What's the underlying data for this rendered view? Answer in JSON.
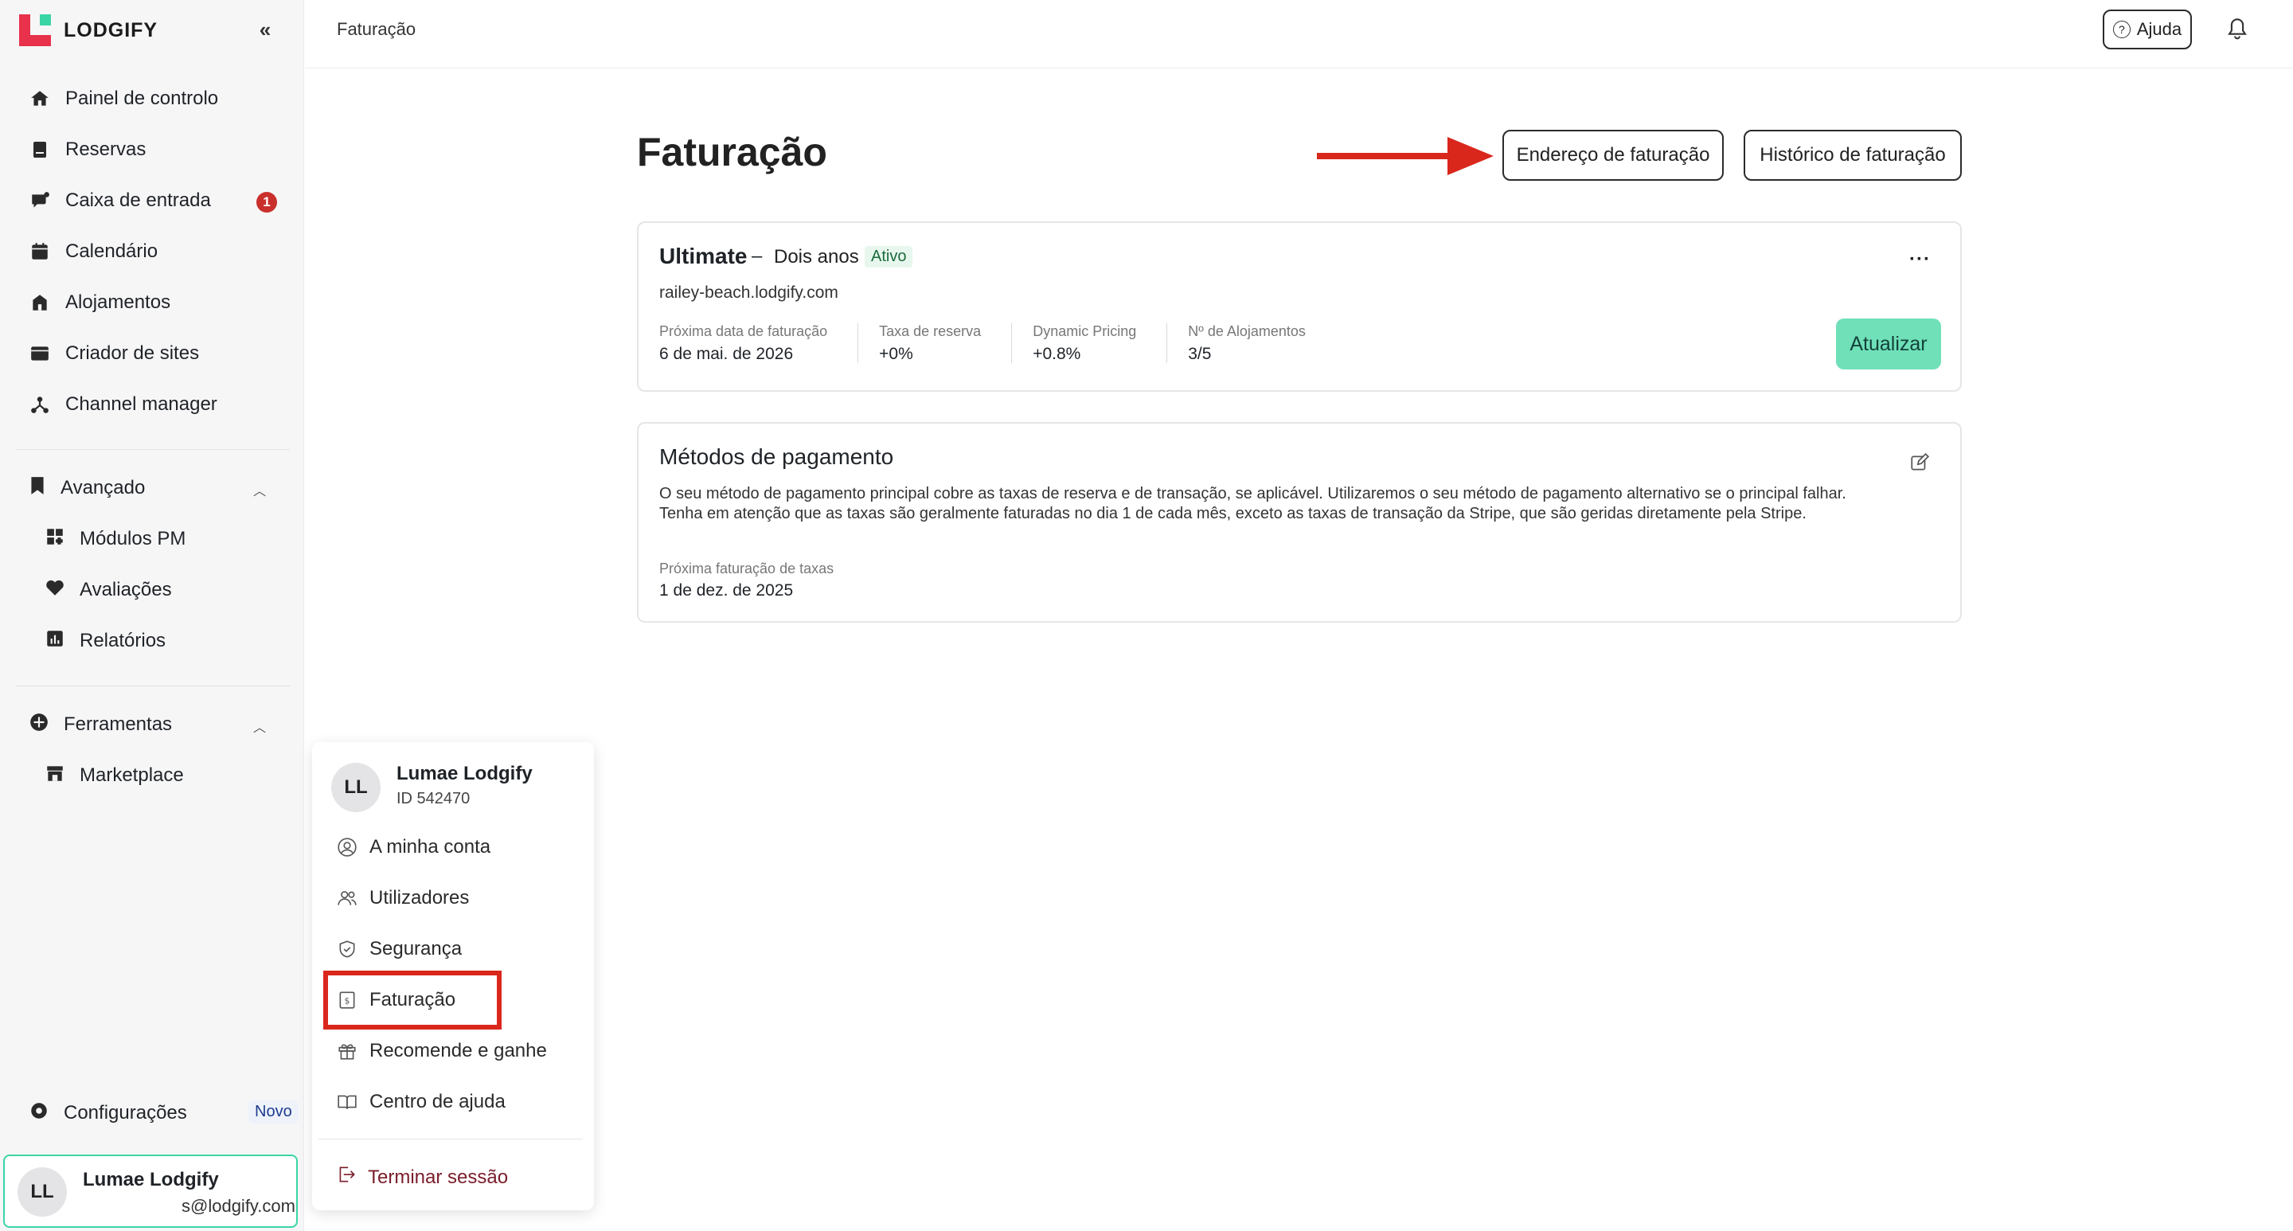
{
  "brand": {
    "name": "LODGIFY"
  },
  "sidebar": {
    "main_items": [
      {
        "label": "Painel de controlo",
        "icon": "home-icon"
      },
      {
        "label": "Reservas",
        "icon": "bookings-icon"
      },
      {
        "label": "Caixa de entrada",
        "icon": "inbox-icon",
        "badge": "1"
      },
      {
        "label": "Calendário",
        "icon": "calendar-icon"
      },
      {
        "label": "Alojamentos",
        "icon": "property-icon"
      },
      {
        "label": "Criador de sites",
        "icon": "website-icon"
      },
      {
        "label": "Channel manager",
        "icon": "channel-icon"
      }
    ],
    "advanced": {
      "label": "Avançado",
      "items": [
        {
          "label": "Módulos PM",
          "icon": "modules-icon"
        },
        {
          "label": "Avaliações",
          "icon": "heart-icon"
        },
        {
          "label": "Relatórios",
          "icon": "reports-icon"
        }
      ]
    },
    "tools": {
      "label": "Ferramentas",
      "items": [
        {
          "label": "Marketplace",
          "icon": "store-icon"
        }
      ]
    },
    "settings": {
      "label": "Configurações",
      "badge": "Novo"
    },
    "user": {
      "initials": "LL",
      "name": "Lumae Lodgify",
      "email": "s@lodgify.com"
    }
  },
  "topbar": {
    "breadcrumb": "Faturação",
    "help_label": "Ajuda"
  },
  "main": {
    "title": "Faturação",
    "address_button": "Endereço de faturação",
    "history_button": "Histórico de faturação",
    "plan": {
      "name": "Ultimate",
      "dash": "–",
      "term": "Dois anos",
      "status": "Ativo",
      "domain": "railey-beach.lodgify.com",
      "more": "···",
      "stats": [
        {
          "label": "Próxima data de faturação",
          "value": "6 de mai. de 2026"
        },
        {
          "label": "Taxa de reserva",
          "value": "+0%"
        },
        {
          "label": "Dynamic Pricing",
          "value": "+0.8%"
        },
        {
          "label": "Nº de Alojamentos",
          "value": "3/5"
        }
      ],
      "update_button": "Atualizar"
    },
    "payment": {
      "title": "Métodos de pagamento",
      "description": "O seu método de pagamento principal cobre as taxas de reserva e de transação, se aplicável. Utilizaremos o seu método de pagamento alternativo se o principal falhar. Tenha em atenção que as taxas são geralmente faturadas no dia 1 de cada mês, exceto as taxas de transação da Stripe, que são geridas diretamente pela Stripe.",
      "next_label": "Próxima faturação de taxas",
      "next_date": "1 de dez. de 2025"
    }
  },
  "user_menu": {
    "initials": "LL",
    "name": "Lumae Lodgify",
    "id": "ID 542470",
    "items": [
      {
        "label": "A minha conta",
        "icon": "account-icon"
      },
      {
        "label": "Utilizadores",
        "icon": "users-icon"
      },
      {
        "label": "Segurança",
        "icon": "shield-icon"
      },
      {
        "label": "Faturação",
        "icon": "billing-icon"
      },
      {
        "label": "Recomende e ganhe",
        "icon": "gift-icon"
      },
      {
        "label": "Centro de ajuda",
        "icon": "book-icon"
      }
    ],
    "logout": "Terminar sessão"
  },
  "colors": {
    "accent": "#6fe0b8",
    "annotation": "#d9271c",
    "brand_red": "#e8314a",
    "brand_green": "#3ad5a5"
  }
}
